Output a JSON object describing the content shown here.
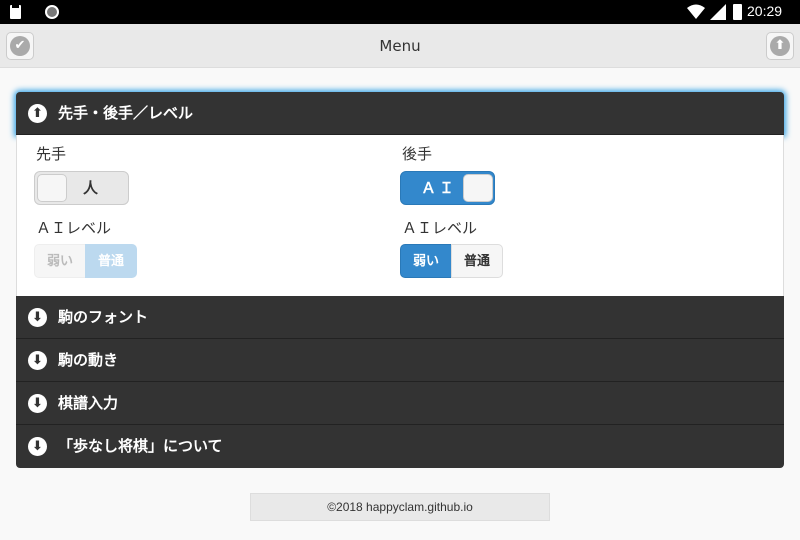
{
  "status_bar": {
    "time": "20:29"
  },
  "header": {
    "title": "Menu",
    "left_icon": "check-icon",
    "right_icon": "arrow-up-icon"
  },
  "sections": [
    {
      "label": "先手・後手／レベル",
      "icon": "arrow-up-icon",
      "expanded": true
    },
    {
      "label": "駒のフォント",
      "icon": "arrow-down-icon",
      "expanded": false
    },
    {
      "label": "駒の動き",
      "icon": "arrow-down-icon",
      "expanded": false
    },
    {
      "label": "棋譜入力",
      "icon": "arrow-down-icon",
      "expanded": false
    },
    {
      "label": "「歩なし将棋」について",
      "icon": "arrow-down-icon",
      "expanded": false
    }
  ],
  "first_player": {
    "label": "先手",
    "toggle_value": "人",
    "level_label": "ＡＩレベル",
    "level_options": [
      "弱い",
      "普通"
    ],
    "level_selected": "普通",
    "level_disabled": true
  },
  "second_player": {
    "label": "後手",
    "toggle_value": "ＡＩ",
    "level_label": "ＡＩレベル",
    "level_options": [
      "弱い",
      "普通"
    ],
    "level_selected": "弱い",
    "level_disabled": false
  },
  "footer": {
    "text": "©2018 happyclam.github.io"
  },
  "colors": {
    "accent": "#3388cc",
    "header_bar": "#333333",
    "focus_glow": "#3aa5e6"
  }
}
